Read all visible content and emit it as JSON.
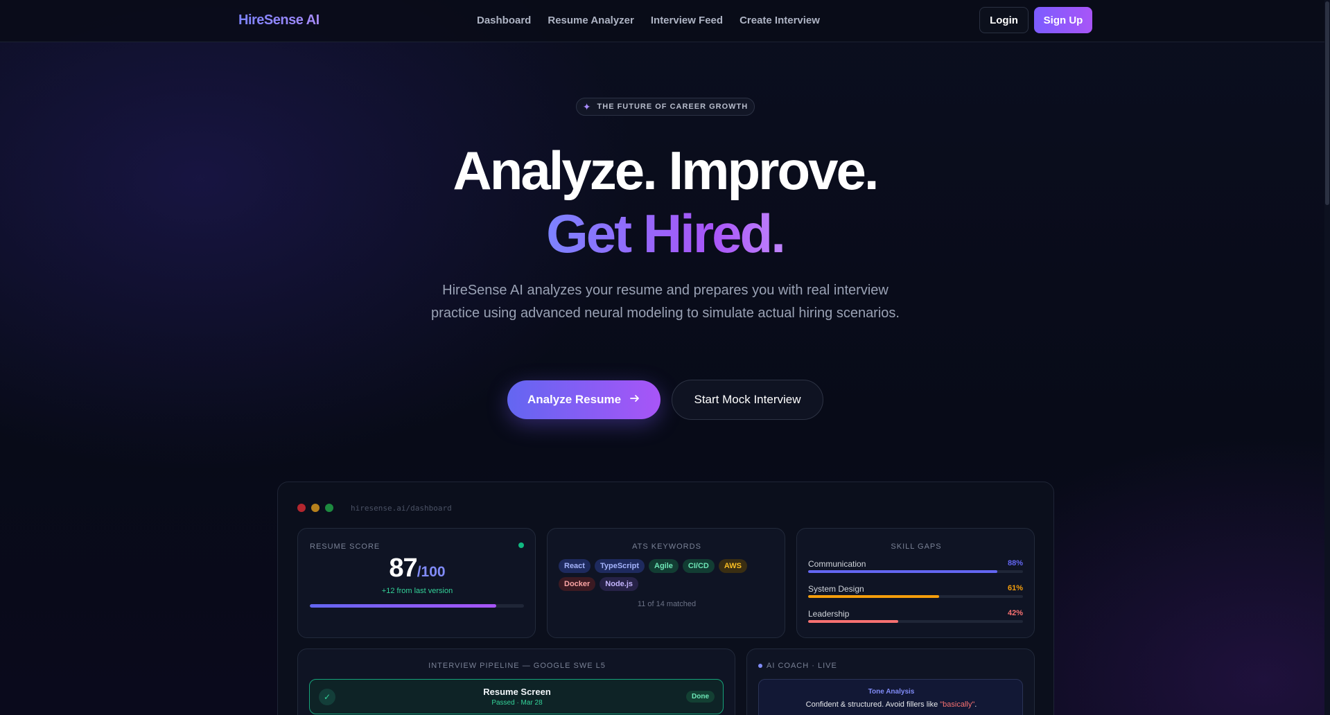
{
  "nav": {
    "brand": "HireSense AI",
    "links": [
      "Dashboard",
      "Resume Analyzer",
      "Interview Feed",
      "Create Interview"
    ],
    "login": "Login",
    "signup": "Sign Up"
  },
  "hero": {
    "badge": "THE FUTURE OF CAREER GROWTH",
    "title_line1": "Analyze. Improve.",
    "title_line2": "Get Hired.",
    "subtitle": "HireSense AI analyzes your resume and prepares you with real interview practice using advanced neural modeling to simulate actual hiring scenarios.",
    "cta_primary": "Analyze Resume",
    "cta_secondary": "Start Mock Interview"
  },
  "dashboard": {
    "url": "hiresense.ai/dashboard",
    "resume_score": {
      "title": "RESUME SCORE",
      "score": "87",
      "out_of": "/100",
      "delta": "+12 from last version",
      "progress": 0.87
    },
    "ats": {
      "title": "ATS KEYWORDS",
      "tags": [
        {
          "label": "React",
          "bg": "#1e2a5e",
          "fg": "#a5b4fc"
        },
        {
          "label": "TypeScript",
          "bg": "#1e2a5e",
          "fg": "#a5b4fc"
        },
        {
          "label": "Agile",
          "bg": "#123d33",
          "fg": "#6ee7b7"
        },
        {
          "label": "CI/CD",
          "bg": "#123d33",
          "fg": "#6ee7b7"
        },
        {
          "label": "AWS",
          "bg": "#3a2e12",
          "fg": "#fbbf24"
        },
        {
          "label": "Docker",
          "bg": "#3b1a22",
          "fg": "#fca5a5"
        },
        {
          "label": "Node.js",
          "bg": "#262247",
          "fg": "#c4b5fd"
        }
      ],
      "matched": "11 of 14 matched"
    },
    "skills": {
      "title": "SKILL GAPS",
      "items": [
        {
          "name": "Communication",
          "pct": "88%",
          "value": 0.88,
          "color": "#6366f1"
        },
        {
          "name": "System Design",
          "pct": "61%",
          "value": 0.61,
          "color": "#f59e0b"
        },
        {
          "name": "Leadership",
          "pct": "42%",
          "value": 0.42,
          "color": "#f87171"
        }
      ]
    },
    "pipeline": {
      "title": "INTERVIEW PIPELINE — GOOGLE SWE L5",
      "stage_name": "Resume Screen",
      "stage_meta": "Passed · Mar 28",
      "stage_status": "Done"
    },
    "coach": {
      "title": "AI COACH · LIVE",
      "tone_title": "Tone Analysis",
      "tone_text": "Confident & structured. Avoid fillers like ",
      "tone_highlight": "\"basically\"",
      "tone_end": "."
    }
  },
  "colors": {
    "accent": "#7c5cff",
    "accent2": "#a855f7",
    "success": "#10b981",
    "background": "#080b16"
  },
  "icons": {
    "badge": "sparkle-icon",
    "cta": "arrow-right-icon",
    "stage": "check-icon"
  }
}
